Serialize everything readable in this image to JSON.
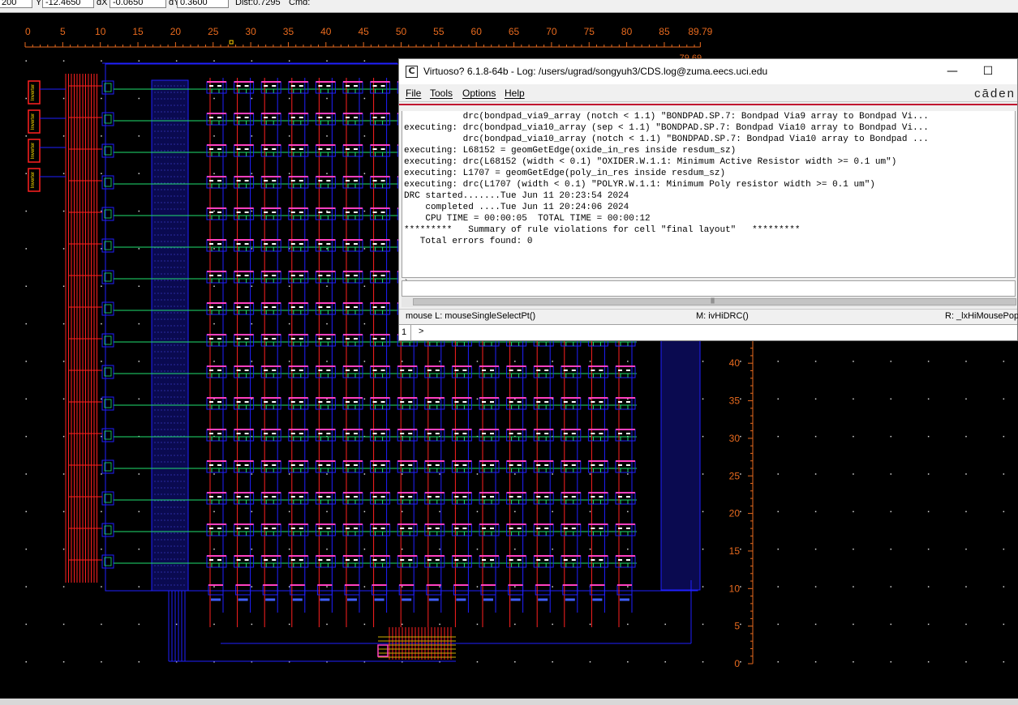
{
  "toolbar": {
    "x_value": "200",
    "y_label": "Y",
    "y_value": "-12.4650",
    "dx_label": "dX",
    "dx_value": "-0.0650",
    "dy_label": "dY",
    "dy_value": "0.3600",
    "dist_label": "Dist:0.7295",
    "cmd_label": "Cmd:"
  },
  "layout": {
    "ruler_x_labels": [
      "0",
      "5",
      "10",
      "15",
      "20",
      "25",
      "30",
      "35",
      "40",
      "45",
      "50",
      "55",
      "60",
      "65",
      "70",
      "75",
      "80",
      "85",
      "89.79"
    ],
    "ruler_x_values": [
      0,
      5,
      10,
      15,
      20,
      25,
      30,
      35,
      40,
      45,
      50,
      55,
      60,
      65,
      70,
      75,
      80,
      85,
      89.79
    ],
    "ruler_y_labels": [
      "40",
      "35",
      "30",
      "25",
      "20",
      "15",
      "10",
      "5",
      "0"
    ],
    "ruler_y_values": [
      40,
      35,
      30,
      25,
      20,
      15,
      10,
      5,
      0
    ],
    "ruler_y_top_label": "79.69",
    "x_range": [
      0,
      89.79
    ],
    "y_range": [
      0,
      79.69
    ],
    "array_columns": 16,
    "array_rows": 16,
    "driver_cell_labels": [
      "Inverter",
      "Inverter",
      "Inverter",
      "Inverter"
    ],
    "colors": {
      "background": "#000000",
      "ruler": "#e86a1e",
      "metal1": "#2020ff",
      "poly": "#ff2020",
      "wordline": "#20e070",
      "cell_top": "#ff40c0",
      "cell_detail": "#ffffff",
      "grid_dot": "#d8d8d8"
    }
  },
  "log_window": {
    "title": "Virtuoso? 6.1.8-64b - Log: /users/ugrad/songyuh3/CDS.log@zuma.eecs.uci.edu",
    "icon_glyph": "C",
    "minimize_glyph": "—",
    "maximize_glyph": "☐",
    "menu": [
      "File",
      "Tools",
      "Options",
      "Help"
    ],
    "brand": "cāden",
    "log_lines": [
      "           drc(bondpad_via9_array (notch < 1.1) \"BONDPAD.SP.7: Bondpad Via9 array to Bondpad Vi...",
      "executing: drc(bondpad_via10_array (sep < 1.1) \"BONDPAD.SP.7: Bondpad Via10 array to Bondpad Vi...",
      "           drc(bondpad_via10_array (notch < 1.1) \"BONDPAD.SP.7: Bondpad Via10 array to Bondpad ...",
      "executing: L68152 = geomGetEdge(oxide_in_res inside resdum_sz)",
      "executing: drc(L68152 (width < 0.1) \"OXIDER.W.1.1: Minimum Active Resistor width >= 0.1 um\")",
      "executing: L1707 = geomGetEdge(poly_in_res inside resdum_sz)",
      "executing: drc(L1707 (width < 0.1) \"POLYR.W.1.1: Minimum Poly resistor width >= 0.1 um\")",
      "DRC started.......Tue Jun 11 20:23:54 2024",
      "    completed ....Tue Jun 11 20:24:06 2024",
      "    CPU TIME = 00:00:05  TOTAL TIME = 00:00:12",
      "*********   Summary of rule violations for cell \"final layout\"   *********",
      "   Total errors found: 0"
    ],
    "cmd_area_mark": "`",
    "scroll_grip": "|||||",
    "status": {
      "left": "mouse L: mouseSingleSelectPt()",
      "middle": "M: ivHiDRC()",
      "right": "R: _lxHiMousePop"
    },
    "cmd_number": "1",
    "cmd_prompt": ">"
  }
}
